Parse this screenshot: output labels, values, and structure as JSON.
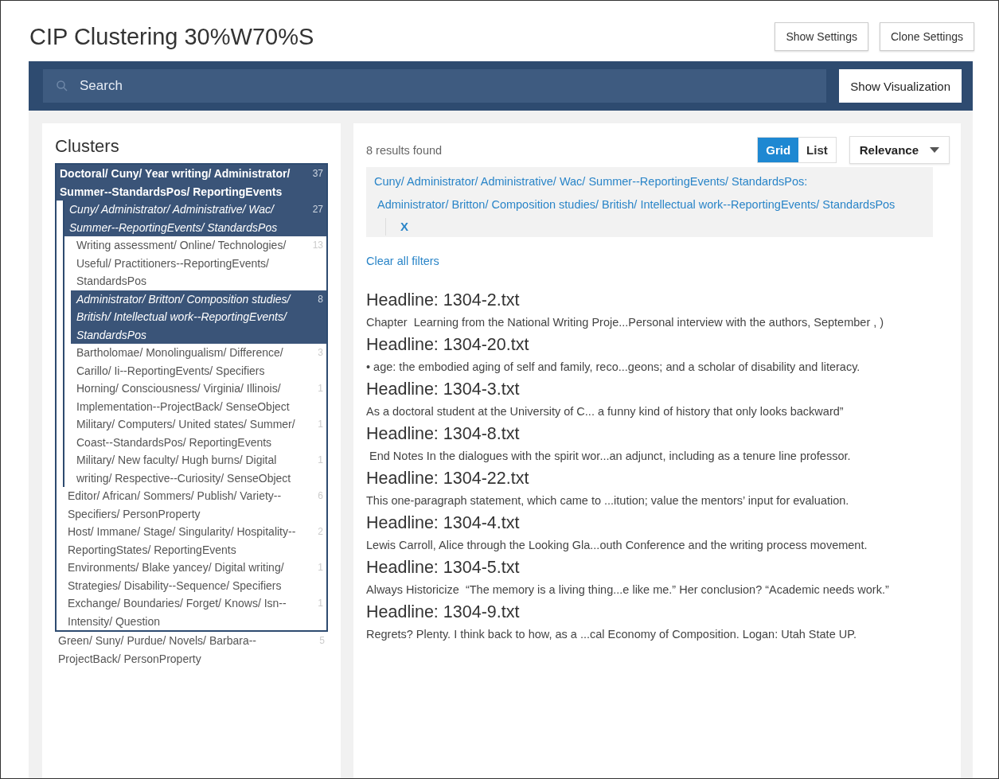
{
  "title": "CIP Clustering 30%W70%S",
  "header_buttons": [
    "Show Settings",
    "Clone Settings"
  ],
  "search": {
    "placeholder": "Search"
  },
  "visualization_button": "Show Visualization",
  "clusters": {
    "heading": "Clusters",
    "items": [
      {
        "label": "Doctoral/ Cuny/ Year writing/ Administrator/ Summer--StandardsPos/ ReportingEvents",
        "count": "37",
        "selected": true,
        "children": [
          {
            "label": "Cuny/ Administrator/ Administrative/ Wac/ Summer--ReportingEvents/ StandardsPos",
            "count": "27",
            "selected": true,
            "children": [
              {
                "label": "Writing assessment/ Online/ Technologies/ Useful/ Practitioners--ReportingEvents/ StandardsPos",
                "count": "13",
                "selected": false
              },
              {
                "label": "Administrator/ Britton/ Composition studies/ British/ Intellectual work--ReportingEvents/ StandardsPos",
                "count": "8",
                "selected": true
              },
              {
                "label": "Bartholomae/ Monolingualism/ Difference/ Carillo/ Ii--ReportingEvents/ Specifiers",
                "count": "3",
                "selected": false
              },
              {
                "label": "Horning/ Consciousness/ Virginia/ Illinois/ Implementation--ProjectBack/ SenseObject",
                "count": "1",
                "selected": false
              },
              {
                "label": "Military/ Computers/ United states/ Summer/ Coast--StandardsPos/ ReportingEvents",
                "count": "1",
                "selected": false
              },
              {
                "label": "Military/ New faculty/ Hugh burns/ Digital writing/ Respective--Curiosity/ SenseObject",
                "count": "1",
                "selected": false
              }
            ]
          },
          {
            "label": "Editor/ African/ Sommers/ Publish/ Variety--Specifiers/ PersonProperty",
            "count": "6",
            "selected": false
          },
          {
            "label": "Host/ Immane/ Stage/ Singularity/ Hospitality--ReportingStates/ ReportingEvents",
            "count": "2",
            "selected": false
          },
          {
            "label": "Environments/ Blake yancey/ Digital writing/ Strategies/ Disability--Sequence/ Specifiers",
            "count": "1",
            "selected": false
          },
          {
            "label": "Exchange/ Boundaries/ Forget/ Knows/ Isn--Intensity/ Question",
            "count": "1",
            "selected": false
          }
        ]
      },
      {
        "label": "Green/ Suny/ Purdue/ Novels/ Barbara--ProjectBack/ PersonProperty",
        "count": "5",
        "selected": false
      }
    ]
  },
  "results": {
    "count_text": "8 results found",
    "view_toggle": [
      {
        "label": "Grid",
        "selected": true
      },
      {
        "label": "List",
        "selected": false
      }
    ],
    "sort": "Relevance",
    "filters": {
      "parent": "Cuny/ Administrator/ Administrative/ Wac/ Summer--ReportingEvents/ StandardsPos:",
      "child": "Administrator/ Britton/ Composition studies/ British/ Intellectual work--ReportingEvents/ StandardsPos",
      "remove": "X"
    },
    "clear_filters": "Clear all filters",
    "items": [
      {
        "headline": "Headline: 1304-2.txt",
        "snippet": "Chapter  Learning from the National Writing Proje...Personal interview with the authors, September , )"
      },
      {
        "headline": "Headline: 1304-20.txt",
        "snippet": "• age: the embodied aging of self and family, reco...geons; and a scholar of disability and literacy."
      },
      {
        "headline": "Headline: 1304-3.txt",
        "snippet": "As a doctoral student at the University of C... a funny kind of history that only looks backward”"
      },
      {
        "headline": "Headline: 1304-8.txt",
        "snippet": " End Notes In the dialogues with the spirit wor...an adjunct, including as a tenure line professor."
      },
      {
        "headline": "Headline: 1304-22.txt",
        "snippet": "This one-paragraph statement, which came to ...itution; value the mentors’ input for evaluation."
      },
      {
        "headline": "Headline: 1304-4.txt",
        "snippet": "Lewis Carroll, Alice through the Looking Gla...outh Conference and the writing process movement."
      },
      {
        "headline": "Headline: 1304-5.txt",
        "snippet": "Always Historicize  “The memory is a living thing...e like me.” Her conclusion? “Academic needs work.”"
      },
      {
        "headline": "Headline: 1304-9.txt",
        "snippet": "Regrets? Plenty. I think back to how, as a ...cal Economy of Composition. Logan: Utah State UP."
      }
    ]
  }
}
